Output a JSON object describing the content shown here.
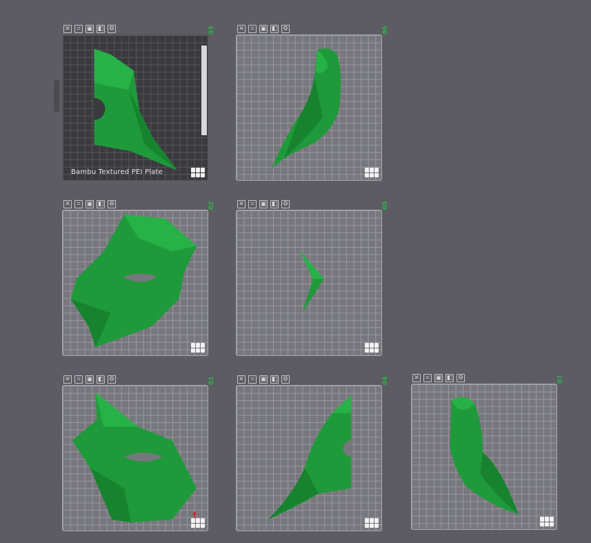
{
  "plates": [
    {
      "number": "03",
      "label": "Bambu Textured PEI Plate",
      "textured": true
    },
    {
      "number": "06",
      "label": "",
      "textured": false
    },
    {
      "number": "02",
      "label": "",
      "textured": false
    },
    {
      "number": "05",
      "label": "",
      "textured": false
    },
    {
      "number": "01",
      "label": "",
      "textured": false
    },
    {
      "number": "04",
      "label": "",
      "textured": false
    },
    {
      "number": "07",
      "label": "",
      "textured": false
    }
  ],
  "toolbar_icons": [
    "close-icon",
    "arrange-icon",
    "lock-icon",
    "layers-icon",
    "settings-icon"
  ],
  "colors": {
    "background": "#5c5c62",
    "model": "#1f9a3a",
    "plate_number": "#2fb24a"
  }
}
